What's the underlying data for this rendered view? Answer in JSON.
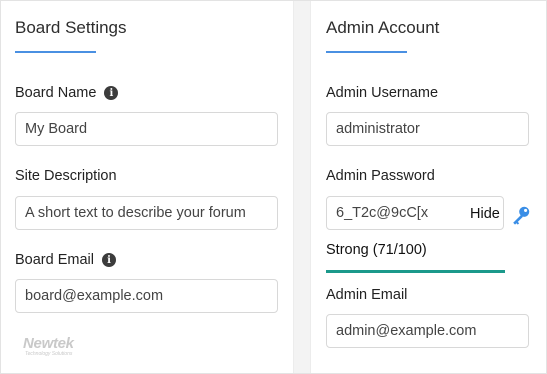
{
  "board": {
    "heading": "Board Settings",
    "name_label": "Board Name",
    "name_value": "My Board",
    "desc_label": "Site Description",
    "desc_value": "A short text to describe your forum",
    "email_label": "Board Email",
    "email_value": "board@example.com"
  },
  "admin": {
    "heading": "Admin Account",
    "username_label": "Admin Username",
    "username_value": "administrator",
    "password_label": "Admin Password",
    "password_value": "6_T2c@9cC[x",
    "hide_label": "Hide",
    "strength_text": "Strong (71/100)",
    "email_label": "Admin Email",
    "email_value": "admin@example.com"
  },
  "icons": {
    "info": "info-icon",
    "key": "key-icon"
  },
  "logo": {
    "main": "Newtek",
    "sub": "Technology Solutions"
  },
  "colors": {
    "accent_underline": "#4a90e2",
    "strength_bar": "#1b998b",
    "key_icon": "#3a8ee6"
  }
}
